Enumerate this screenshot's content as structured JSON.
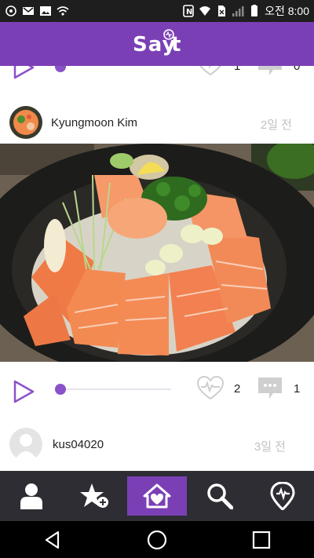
{
  "status_bar": {
    "carrier_text": "오전 8:00",
    "left_icons": [
      "location-search-icon",
      "gmail-icon",
      "image-icon",
      "wifi-call-icon"
    ],
    "right_icons": [
      "nfc-icon",
      "wifi-icon",
      "no-sim-icon",
      "signal-icon",
      "battery-icon"
    ]
  },
  "header": {
    "logo_text": "Say t",
    "brand_color": "#7b3fb5"
  },
  "feed": {
    "top_action_row": {
      "likes": "1",
      "comments": "0"
    },
    "posts": [
      {
        "username": "Kyungmoon  Kim",
        "time_ago": "2일 전",
        "image": "salmon-rice-bowl-photo",
        "likes": "2",
        "comments": "1",
        "audio_progress": 0
      },
      {
        "username": "kus04020",
        "time_ago": "3일 전"
      }
    ]
  },
  "bottom_nav": {
    "items": [
      {
        "name": "profile",
        "icon": "person-icon"
      },
      {
        "name": "favorites",
        "icon": "star-plus-icon"
      },
      {
        "name": "home",
        "icon": "home-heart-icon",
        "active": true
      },
      {
        "name": "search",
        "icon": "search-icon"
      },
      {
        "name": "sayit",
        "icon": "heartbeat-location-icon"
      }
    ]
  },
  "system_nav": {
    "buttons": [
      "back",
      "home",
      "recents"
    ]
  }
}
